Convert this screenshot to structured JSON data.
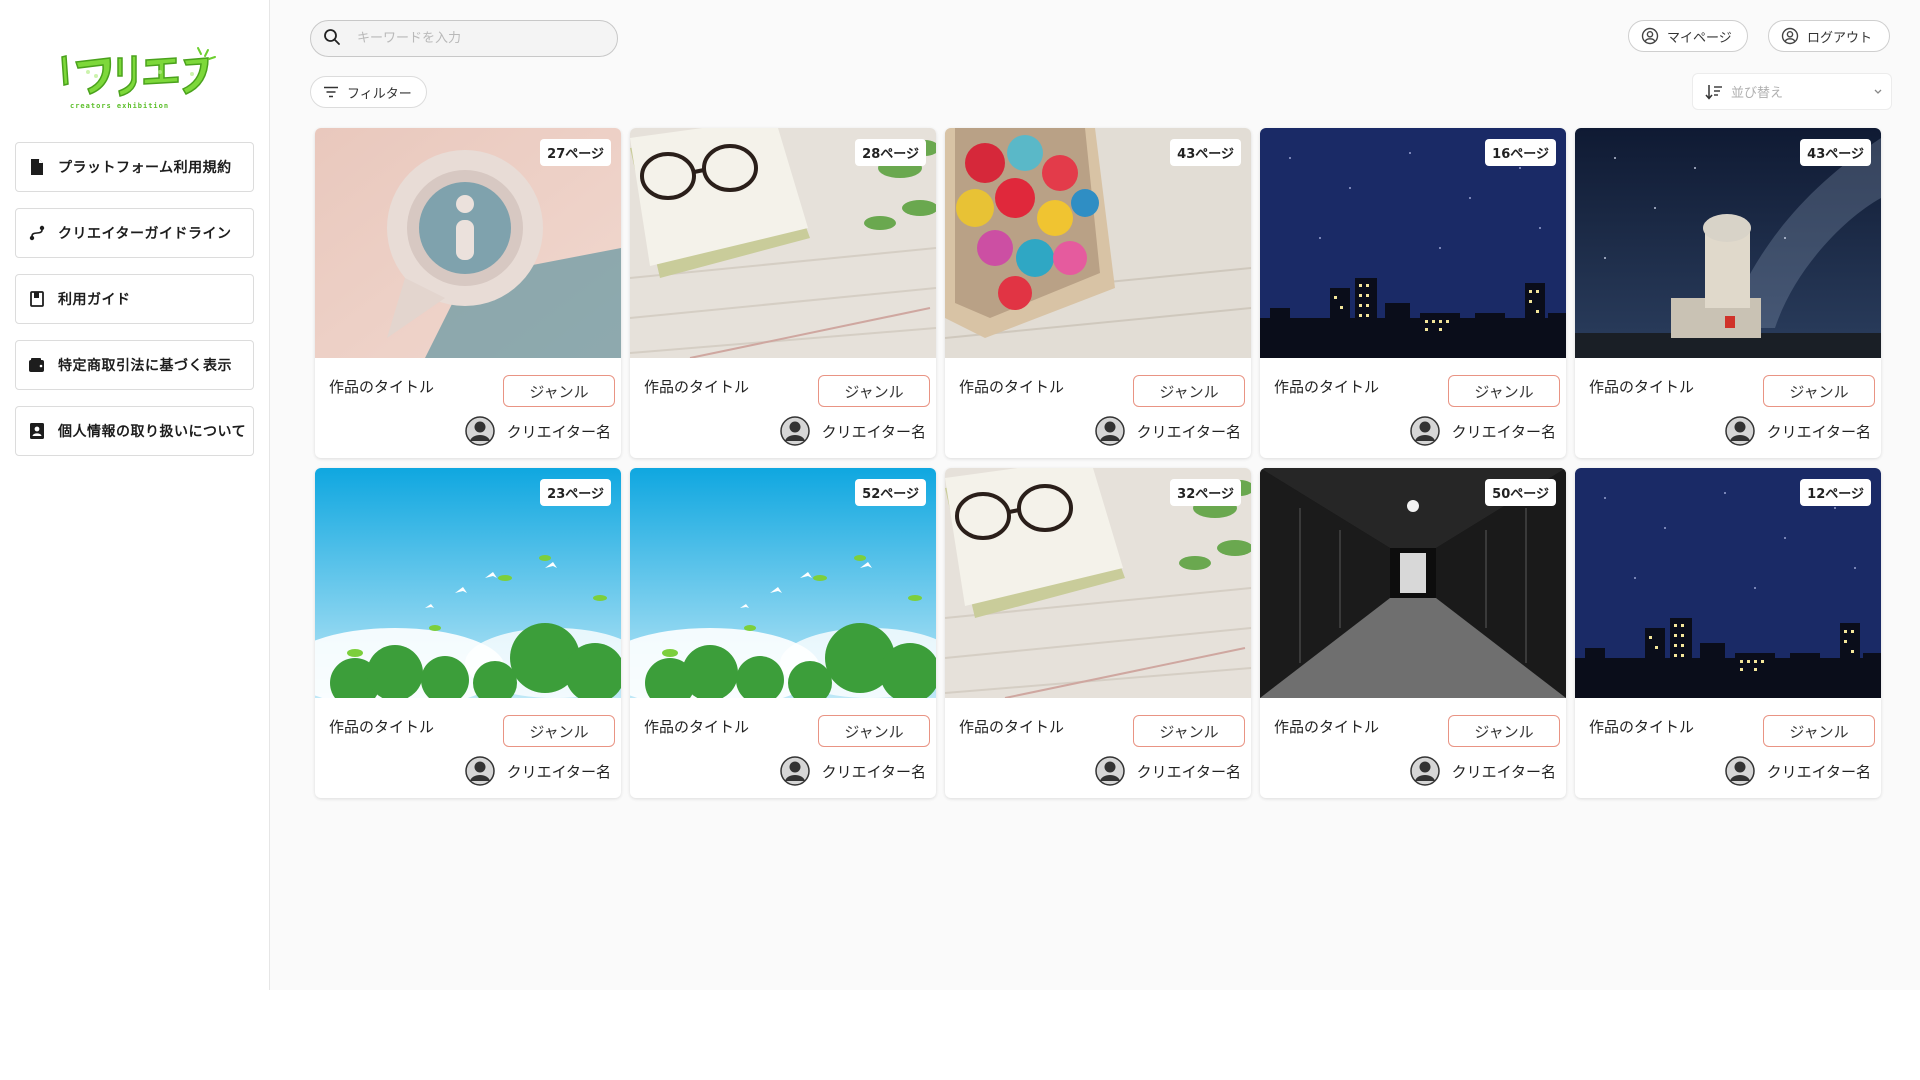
{
  "logo": {
    "text": "クリエク",
    "subtitle": "creators exhibition"
  },
  "sidebar": {
    "items": [
      {
        "label": "プラットフォーム利用規約",
        "icon": "document-icon"
      },
      {
        "label": "クリエイターガイドライン",
        "icon": "route-icon"
      },
      {
        "label": "利用ガイド",
        "icon": "book-icon"
      },
      {
        "label": "特定商取引法に基づく表示",
        "icon": "wallet-icon"
      },
      {
        "label": "個人情報の取り扱いについて",
        "icon": "contact-card-icon"
      }
    ]
  },
  "header": {
    "search_placeholder": "キーワードを入力",
    "filter_label": "フィルター",
    "mypage_label": "マイページ",
    "logout_label": "ログアウト",
    "sort_placeholder": "並び替え"
  },
  "cards": [
    {
      "pages": "27ページ",
      "title": "作品のタイトル",
      "genre": "ジャンル",
      "creator": "クリエイター名",
      "image": "info-bubble"
    },
    {
      "pages": "28ページ",
      "title": "作品のタイトル",
      "genre": "ジャンル",
      "creator": "クリエイター名",
      "image": "glasses-book"
    },
    {
      "pages": "43ページ",
      "title": "作品のタイトル",
      "genre": "ジャンル",
      "creator": "クリエイター名",
      "image": "heart-chocolates"
    },
    {
      "pages": "16ページ",
      "title": "作品のタイトル",
      "genre": "ジャンル",
      "creator": "クリエイター名",
      "image": "night-city"
    },
    {
      "pages": "43ページ",
      "title": "作品のタイトル",
      "genre": "ジャンル",
      "creator": "クリエイター名",
      "image": "observatory-night"
    },
    {
      "pages": "23ページ",
      "title": "作品のタイトル",
      "genre": "ジャンル",
      "creator": "クリエイター名",
      "image": "sky-birds"
    },
    {
      "pages": "52ページ",
      "title": "作品のタイトル",
      "genre": "ジャンル",
      "creator": "クリエイター名",
      "image": "sky-birds"
    },
    {
      "pages": "32ページ",
      "title": "作品のタイトル",
      "genre": "ジャンル",
      "creator": "クリエイター名",
      "image": "glasses-book"
    },
    {
      "pages": "50ページ",
      "title": "作品のタイトル",
      "genre": "ジャンル",
      "creator": "クリエイター名",
      "image": "dark-corridor"
    },
    {
      "pages": "12ページ",
      "title": "作品のタイトル",
      "genre": "ジャンル",
      "creator": "クリエイター名",
      "image": "night-city"
    }
  ],
  "colors": {
    "logo_green": "#6ccf2e",
    "genre_border": "#e99484",
    "main_bg": "#fafafa"
  }
}
